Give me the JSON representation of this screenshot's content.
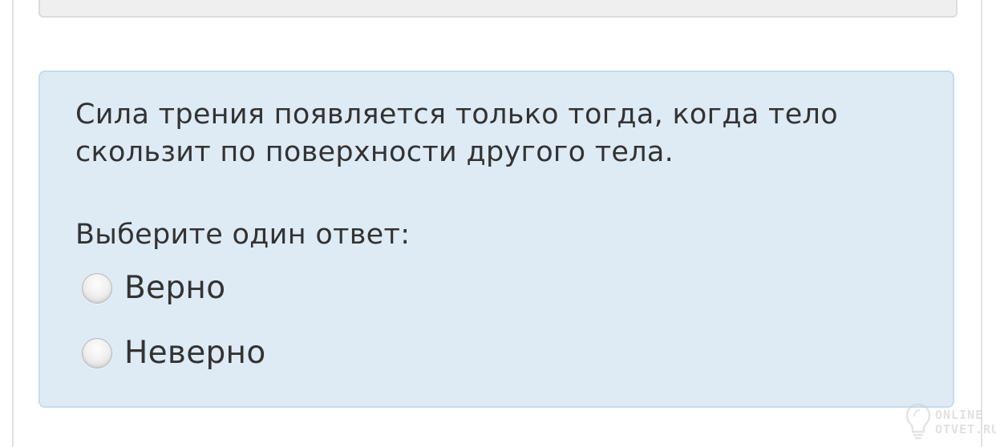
{
  "question": {
    "text": "Сила трения появляется только тогда, когда тело скользит по поверхности другого тела.",
    "prompt": "Выберите один ответ:",
    "options": [
      {
        "label": "Верно",
        "selected": false
      },
      {
        "label": "Неверно",
        "selected": false
      }
    ]
  },
  "watermark": {
    "line1": "ONLINE",
    "line2": "OTVET.RU",
    "icon": "lightbulb-icon"
  },
  "colors": {
    "question_bg": "#deebf5",
    "question_border": "#c5dcea",
    "text": "#333333",
    "prev_box_bg": "#efefef"
  }
}
